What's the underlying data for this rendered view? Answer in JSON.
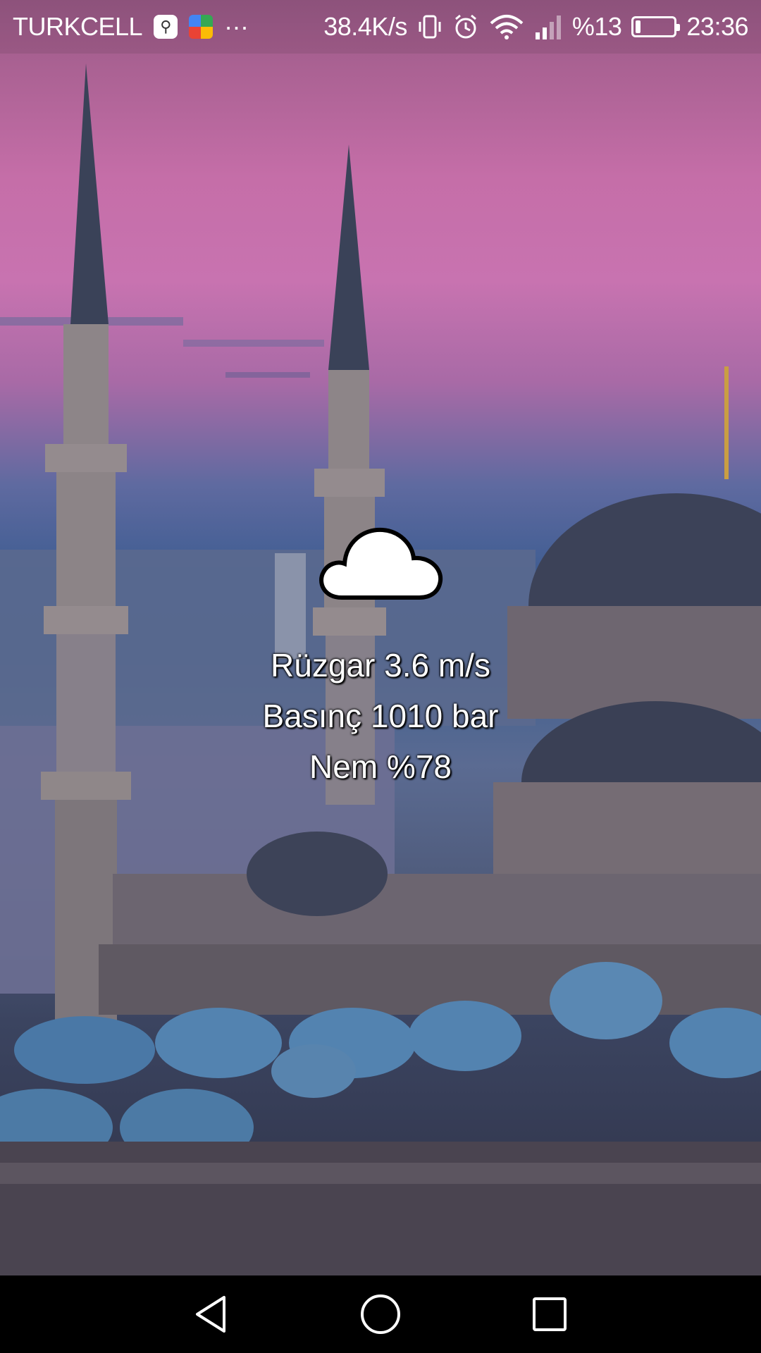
{
  "status_bar": {
    "carrier": "TURKCELL",
    "more_indicator": "···",
    "network_speed": "38.4K/s",
    "battery_percent": "%13",
    "battery_level": 0.13,
    "time": "23:36",
    "icons": [
      "app-notification-icon",
      "google-play-icon",
      "vibrate-icon",
      "alarm-icon",
      "wifi-icon",
      "signal-icon",
      "battery-icon"
    ]
  },
  "weather": {
    "condition_icon": "cloud-icon",
    "wind": "Rüzgar 3.6 m/s",
    "pressure": "Basınç 1010 bar",
    "humidity": "Nem %78"
  },
  "nav_bar": {
    "buttons": [
      "back-icon",
      "home-icon",
      "recents-icon"
    ]
  },
  "colors": {
    "sky_top": "#c873b0",
    "sky_bottom": "#3f5d92",
    "text": "#ffffff",
    "nav_background": "#000000"
  }
}
